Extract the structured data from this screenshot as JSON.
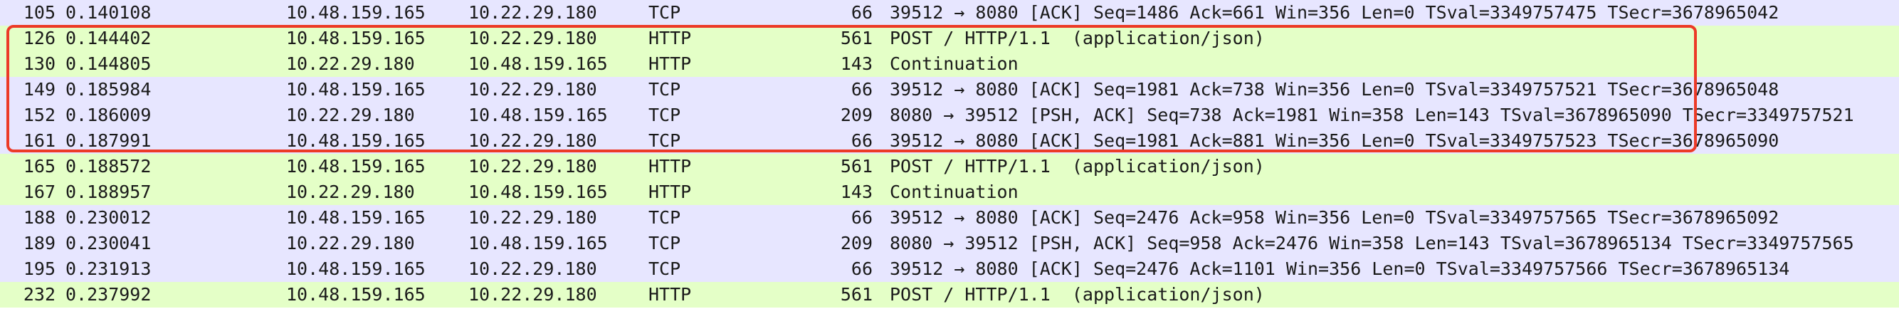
{
  "packets": [
    {
      "no": "105",
      "time": "0.140108",
      "source": "10.48.159.165",
      "destination": "10.22.29.180",
      "protocol": "TCP",
      "length": "66",
      "info": "39512 → 8080 [ACK] Seq=1486 Ack=661 Win=356 Len=0 TSval=3349757475 TSecr=3678965042"
    },
    {
      "no": "126",
      "time": "0.144402",
      "source": "10.48.159.165",
      "destination": "10.22.29.180",
      "protocol": "HTTP",
      "length": "561",
      "info": "POST / HTTP/1.1  (application/json)"
    },
    {
      "no": "130",
      "time": "0.144805",
      "source": "10.22.29.180",
      "destination": "10.48.159.165",
      "protocol": "HTTP",
      "length": "143",
      "info": "Continuation"
    },
    {
      "no": "149",
      "time": "0.185984",
      "source": "10.48.159.165",
      "destination": "10.22.29.180",
      "protocol": "TCP",
      "length": "66",
      "info": "39512 → 8080 [ACK] Seq=1981 Ack=738 Win=356 Len=0 TSval=3349757521 TSecr=3678965048"
    },
    {
      "no": "152",
      "time": "0.186009",
      "source": "10.22.29.180",
      "destination": "10.48.159.165",
      "protocol": "TCP",
      "length": "209",
      "info": "8080 → 39512 [PSH, ACK] Seq=738 Ack=1981 Win=358 Len=143 TSval=3678965090 TSecr=3349757521"
    },
    {
      "no": "161",
      "time": "0.187991",
      "source": "10.48.159.165",
      "destination": "10.22.29.180",
      "protocol": "TCP",
      "length": "66",
      "info": "39512 → 8080 [ACK] Seq=1981 Ack=881 Win=356 Len=0 TSval=3349757523 TSecr=3678965090"
    },
    {
      "no": "165",
      "time": "0.188572",
      "source": "10.48.159.165",
      "destination": "10.22.29.180",
      "protocol": "HTTP",
      "length": "561",
      "info": "POST / HTTP/1.1  (application/json)"
    },
    {
      "no": "167",
      "time": "0.188957",
      "source": "10.22.29.180",
      "destination": "10.48.159.165",
      "protocol": "HTTP",
      "length": "143",
      "info": "Continuation"
    },
    {
      "no": "188",
      "time": "0.230012",
      "source": "10.48.159.165",
      "destination": "10.22.29.180",
      "protocol": "TCP",
      "length": "66",
      "info": "39512 → 8080 [ACK] Seq=2476 Ack=958 Win=356 Len=0 TSval=3349757565 TSecr=3678965092"
    },
    {
      "no": "189",
      "time": "0.230041",
      "source": "10.22.29.180",
      "destination": "10.48.159.165",
      "protocol": "TCP",
      "length": "209",
      "info": "8080 → 39512 [PSH, ACK] Seq=958 Ack=2476 Win=358 Len=143 TSval=3678965134 TSecr=3349757565"
    },
    {
      "no": "195",
      "time": "0.231913",
      "source": "10.48.159.165",
      "destination": "10.22.29.180",
      "protocol": "TCP",
      "length": "66",
      "info": "39512 → 8080 [ACK] Seq=2476 Ack=1101 Win=356 Len=0 TSval=3349757566 TSecr=3678965134"
    },
    {
      "no": "232",
      "time": "0.237992",
      "source": "10.48.159.165",
      "destination": "10.22.29.180",
      "protocol": "HTTP",
      "length": "561",
      "info": "POST / HTTP/1.1  (application/json)"
    }
  ],
  "protocol_colors": {
    "TCP": "#e7e6ff",
    "HTTP": "#e4ffc7"
  },
  "highlight_color": "#ec3a27"
}
